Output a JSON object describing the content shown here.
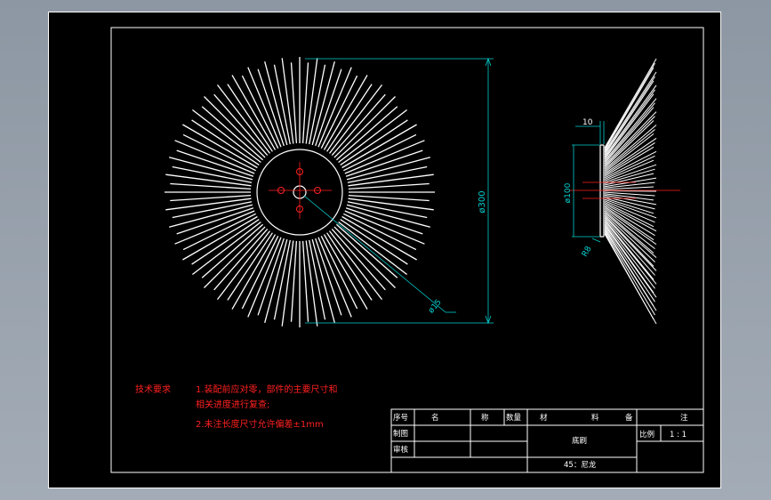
{
  "colors": {
    "line": "#ffffff",
    "dimension": "#00d0d0",
    "center": "#ff2020",
    "note": "#ff2020",
    "background": "#000000"
  },
  "dimensions": {
    "outer_diameter": "ø300",
    "hub_diameter": "ø100",
    "bore_diameter": "ø15",
    "width": "10",
    "radius": "R8"
  },
  "notes": {
    "heading": "技术要求",
    "line1a": "1.装配前应对零，部件的主要尺寸和",
    "line1b": "相关进度进行复查;",
    "line2": "2.未注长度尺寸允许偏差±1mm"
  },
  "title_block": {
    "h_seq": "序号",
    "h_name_a": "名",
    "h_name_b": "称",
    "h_qty": "数量",
    "h_mat_a": "材",
    "h_mat_b": "料",
    "h_rem_a": "备",
    "h_rem_b": "注",
    "drawn": "制图",
    "checked": "审核",
    "part_name": "底刷",
    "scale_label": "比例",
    "scale_value": "1 : 1",
    "material": "45：尼龙"
  }
}
